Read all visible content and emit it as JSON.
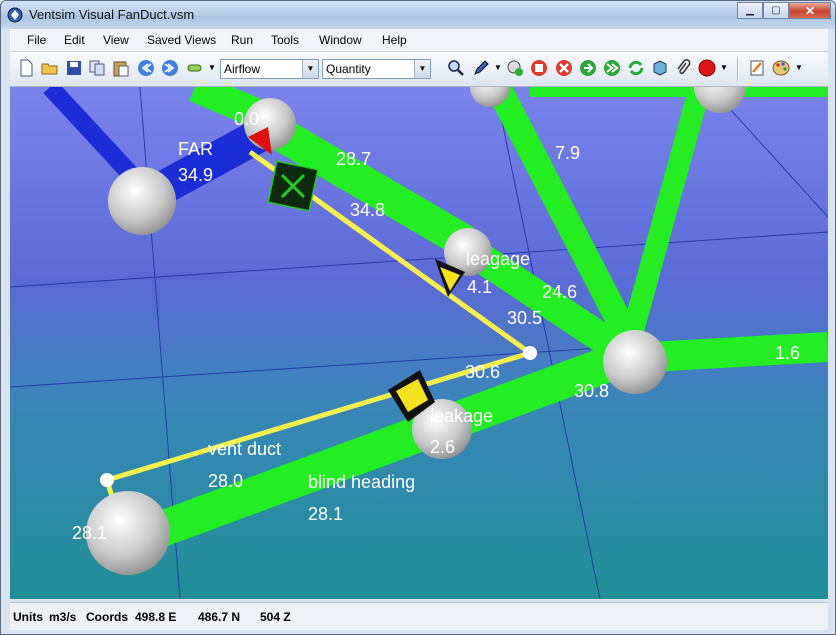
{
  "window": {
    "title": "Ventsim Visual   FanDuct.vsm"
  },
  "menu": [
    "File",
    "Edit",
    "View",
    "Saved Views",
    "Run",
    "Tools",
    "Window",
    "Help"
  ],
  "toolbar": {
    "combo1": "Airflow",
    "combo2": "Quantity"
  },
  "scene_labels": {
    "far": "FAR",
    "far_value": "34.9",
    "top_zero": "0.0",
    "v28_7": "28.7",
    "v7_9": "7.9",
    "v34_8": "34.8",
    "leakage1": "leagage",
    "leakage1_value": "4.1",
    "v24_6": "24.6",
    "v30_5": "30.5",
    "v30_6": "30.6",
    "v30_8": "30.8",
    "v1_6": "1.6",
    "leakage2": "leakage",
    "leakage2_value": "2.6",
    "vent_duct": "vent duct",
    "vent_duct_value": "28.0",
    "blind_heading": "blind heading",
    "blind_heading_value": "28.1",
    "node_left_value": "28.1"
  },
  "status": {
    "units_label": "Units",
    "units_value": "m3/s",
    "coords_label": "Coords",
    "easting": "498.8 E",
    "northing": "486.7 N",
    "elevation": "504 Z"
  },
  "colors": {
    "airway": "#22ee22",
    "duct": "#f5f04a",
    "fresh_air": "#1a2fd8",
    "sky_top": "#7a84e8",
    "floor": "#2a8fa0"
  }
}
